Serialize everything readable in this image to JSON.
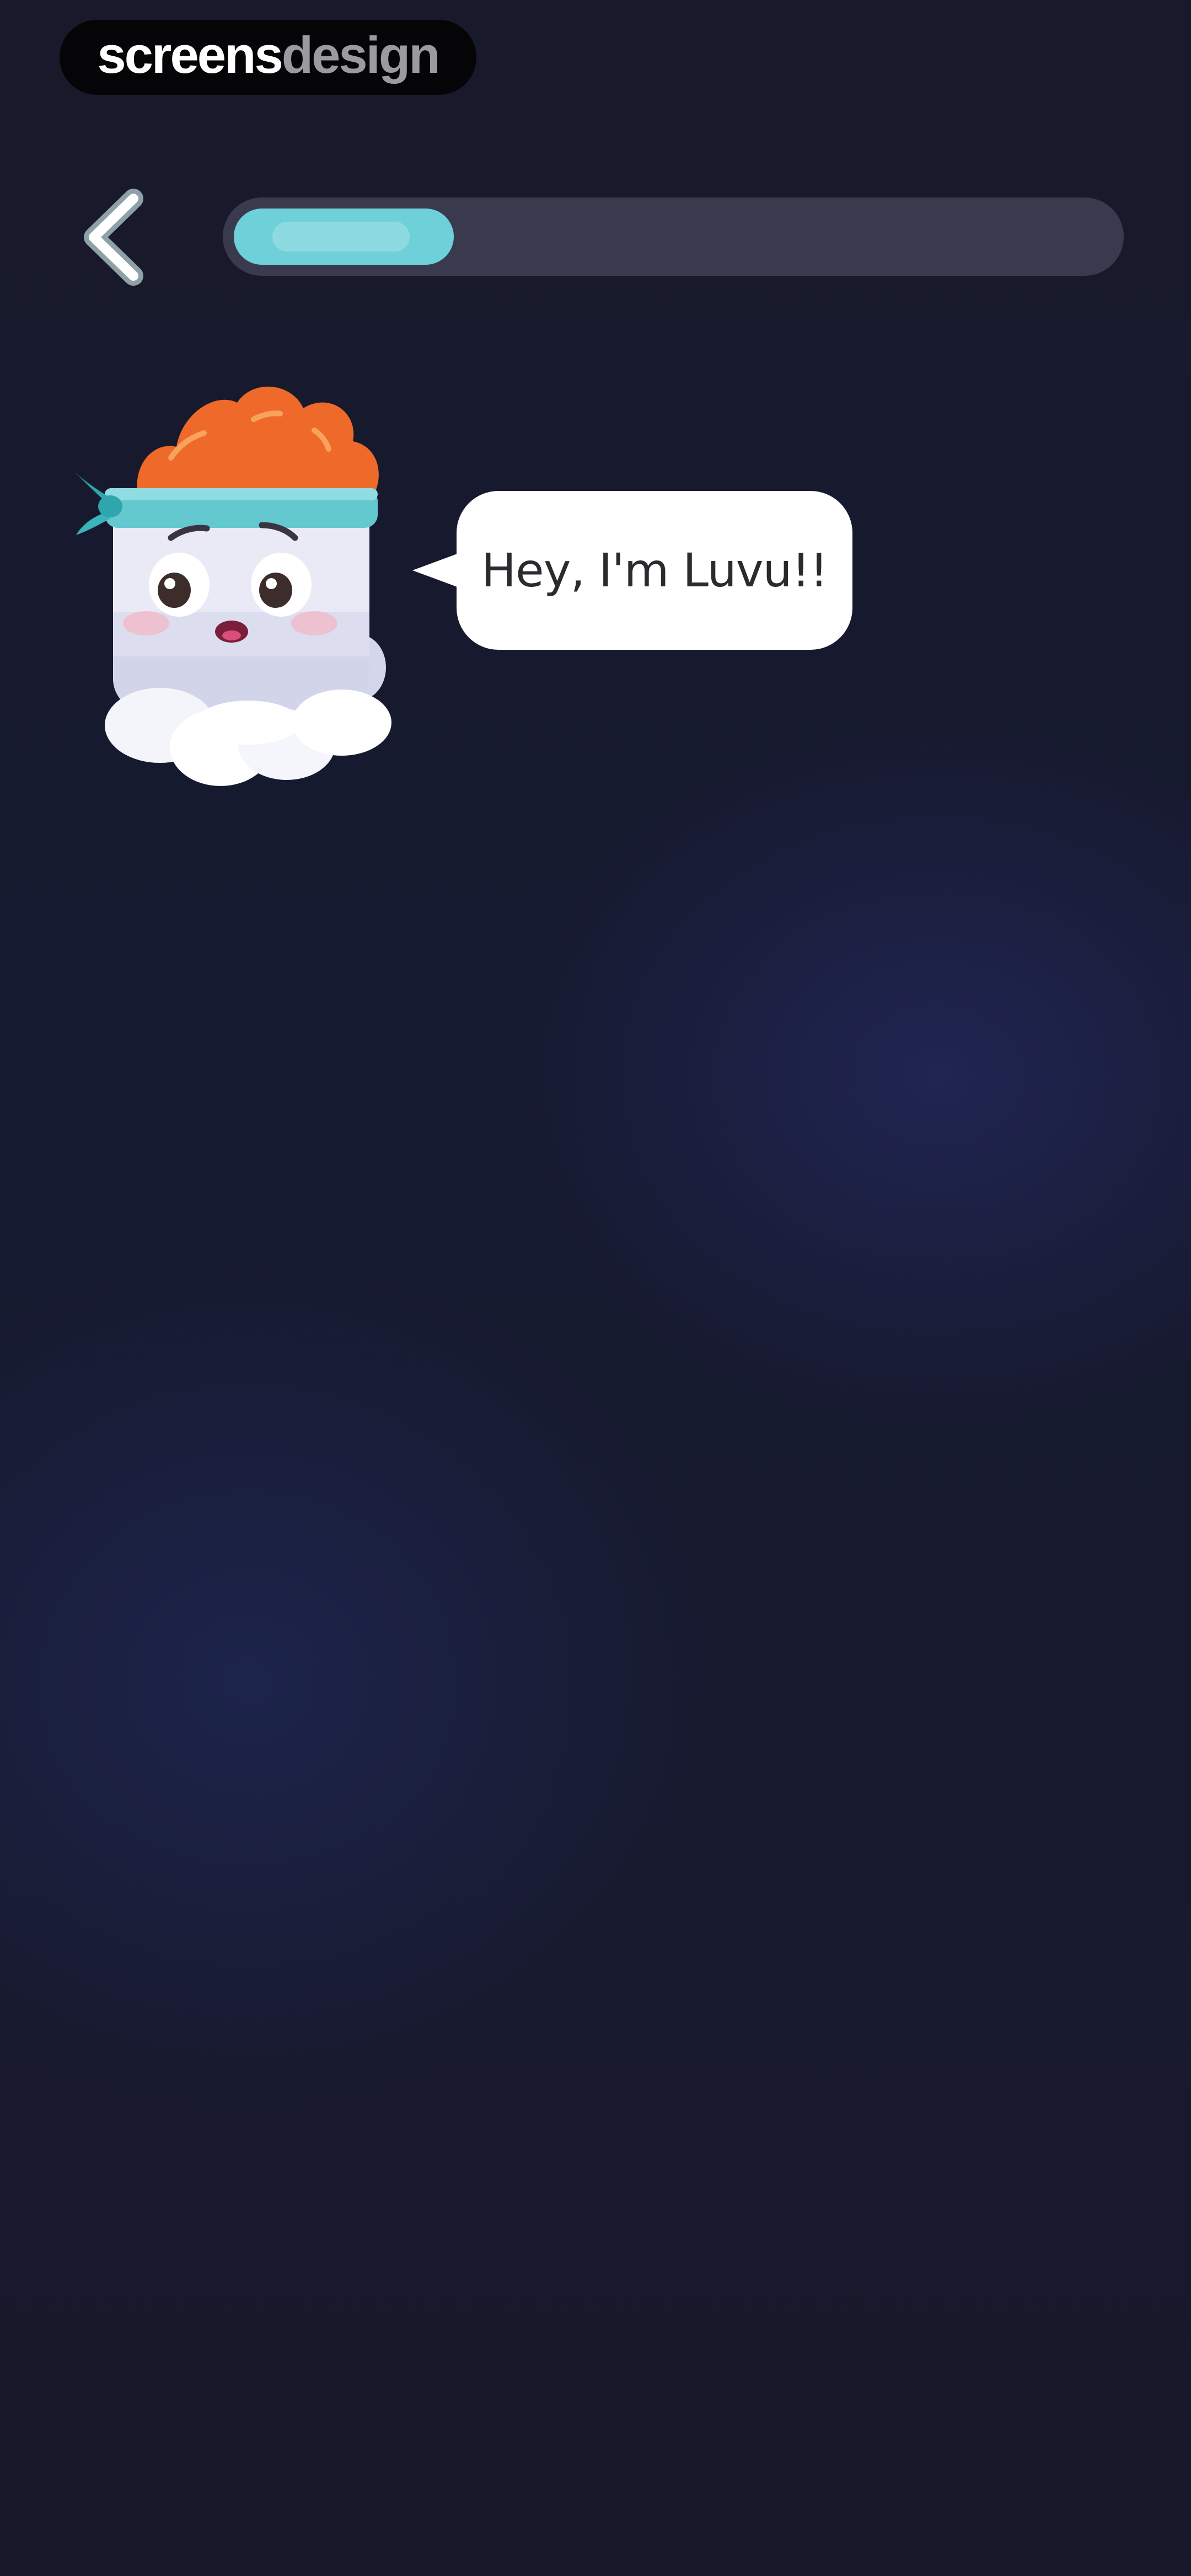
{
  "watermark": {
    "part1": "screens",
    "part2": "design"
  },
  "header": {
    "back_icon": "chevron-left-icon",
    "progress_fraction": 0.25
  },
  "mascot": {
    "icon": "luvu-mascot-icon"
  },
  "speech": {
    "text": "Hey, I'm Luvu!!"
  },
  "colors": {
    "background": "#171a2e",
    "progress_track": "#3a3a4f",
    "progress_fill": "#6ed0d9",
    "bubble": "#ffffff",
    "bubble_text": "#2b2b2f"
  }
}
